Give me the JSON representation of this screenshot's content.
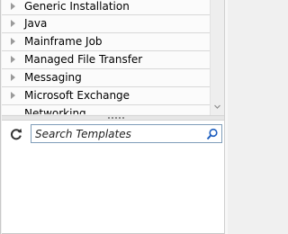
{
  "template_tree": {
    "items": [
      {
        "label": "Generic Installation"
      },
      {
        "label": "Java"
      },
      {
        "label": "Mainframe Job"
      },
      {
        "label": "Managed File Transfer"
      },
      {
        "label": "Messaging"
      },
      {
        "label": "Microsoft Exchange"
      },
      {
        "label": "Networking"
      }
    ]
  },
  "search": {
    "placeholder": "Search Templates",
    "value": ""
  },
  "icons": {
    "refresh": "refresh-icon",
    "search": "search-icon",
    "expand": "chevron-right-icon",
    "scroll_down": "chevron-down-icon"
  },
  "colors": {
    "search_icon": "#1f5fbf",
    "refresh_icon": "#333333",
    "border": "#7f9db9"
  }
}
